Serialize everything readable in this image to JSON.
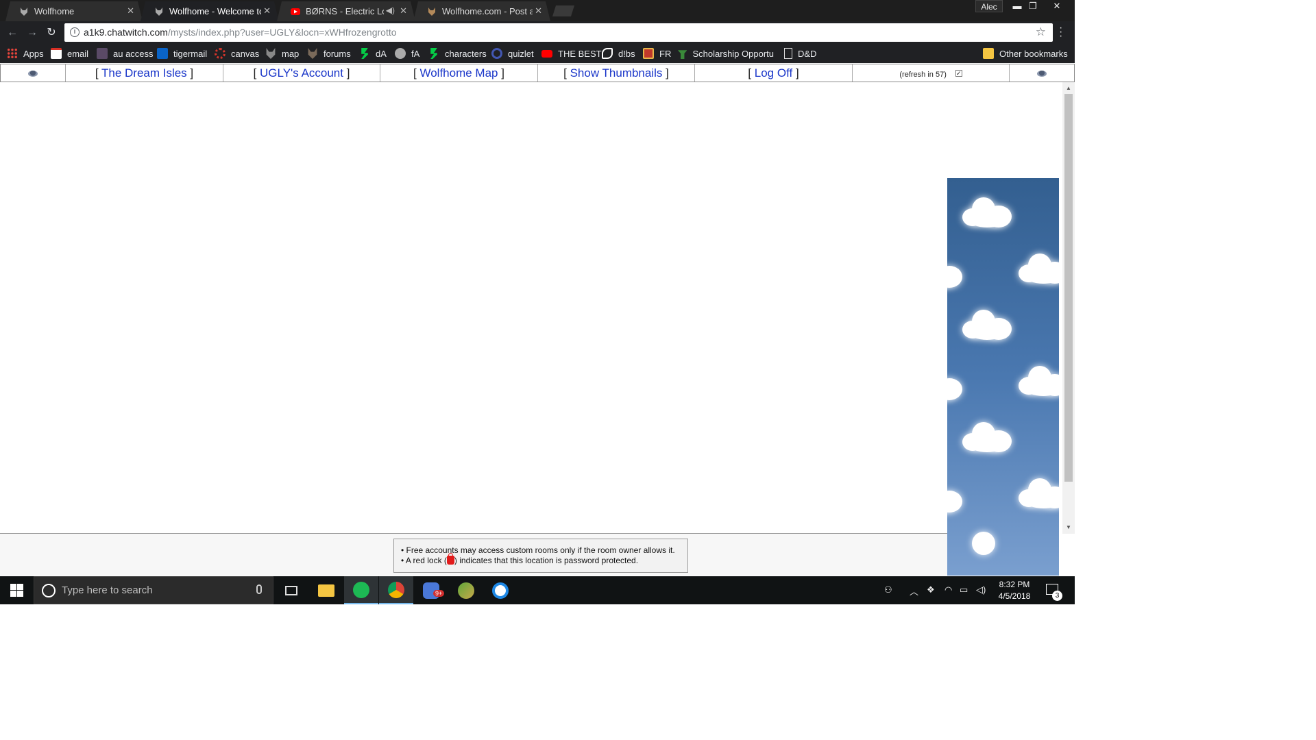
{
  "browser": {
    "tabs": [
      {
        "title": "Wolfhome",
        "favicon": "wolf-icon"
      },
      {
        "title": "Wolfhome - Welcome to",
        "favicon": "wolf-icon"
      },
      {
        "title": "BØRNS - Electric Love",
        "favicon": "youtube-icon",
        "audio": true
      },
      {
        "title": "Wolfhome.com - Post a r",
        "favicon": "wolf-icon"
      }
    ],
    "profile_name": "Alec",
    "url_host": "a1k9.chatwitch.com",
    "url_rest": "/mysts/index.php?user=UGLY&locn=xWHfrozengrotto",
    "bookmarks": [
      {
        "label": "Apps",
        "icon": "apps-grid-icon",
        "color": "#e8453c"
      },
      {
        "label": "email",
        "icon": "gmail-icon",
        "color": "#d93025"
      },
      {
        "label": "au access",
        "icon": "au-icon",
        "color": "#5a4a66"
      },
      {
        "label": "tigermail",
        "icon": "outlook-icon",
        "color": "#0a64c8"
      },
      {
        "label": "canvas",
        "icon": "canvas-icon",
        "color": "#d3352b"
      },
      {
        "label": "map",
        "icon": "wolf-icon",
        "color": "#888888"
      },
      {
        "label": "forums",
        "icon": "wolf-icon",
        "color": "#7a6a5a"
      },
      {
        "label": "dA",
        "icon": "deviantart-icon",
        "color": "#05cc47"
      },
      {
        "label": "fA",
        "icon": "furaffinity-icon",
        "color": "#aaaaaa"
      },
      {
        "label": "characters",
        "icon": "deviantart-icon",
        "color": "#05cc47"
      },
      {
        "label": "quizlet",
        "icon": "quizlet-icon",
        "color": "#4257b2"
      },
      {
        "label": "THE BEST",
        "icon": "youtube-icon",
        "color": "#ff0000"
      },
      {
        "label": "d!bs",
        "icon": "dibs-icon",
        "color": "#ffffff"
      },
      {
        "label": "FR",
        "icon": "fr-icon",
        "color": "#c0392b"
      },
      {
        "label": "Scholarship Opportu",
        "icon": "scholarship-icon",
        "color": "#3a8a3a"
      },
      {
        "label": "D&D",
        "icon": "page-icon",
        "color": "#dddddd"
      }
    ],
    "other_bookmarks": "Other bookmarks"
  },
  "site_nav": {
    "open_bracket": "[",
    "close_bracket": "]",
    "links": [
      "The Dream Isles",
      "UGLY's Account",
      "Wolfhome Map",
      "Show Thumbnails",
      "Log Off"
    ],
    "refresh_text": "(refresh in 57)",
    "refresh_checked": true
  },
  "notice": {
    "line1": "• Free accounts may access custom rooms only if the room owner allows it.",
    "line2_before": "• A red lock (",
    "line2_after": ") indicates that this location is password protected."
  },
  "taskbar": {
    "search_placeholder": "Type here to search",
    "apps": [
      "file-explorer-icon",
      "spotify-icon",
      "chrome-icon",
      "messenger-icon",
      "minecraft-icon",
      "uplay-icon"
    ],
    "time": "8:32 PM",
    "date": "4/5/2018",
    "notification_count": "3",
    "messenger_badge": "9+"
  },
  "colors": {
    "link_blue": "#1a36c9",
    "sky_top": "#335f90",
    "sky_bottom": "#7a9fcf"
  }
}
